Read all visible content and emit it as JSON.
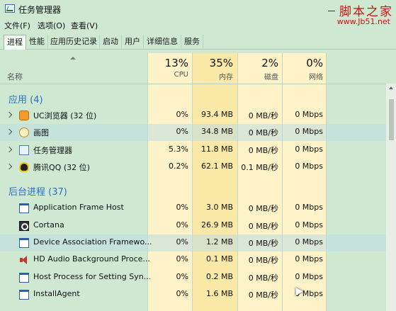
{
  "window": {
    "title": "任务管理器"
  },
  "watermark": {
    "text": "脚本之家",
    "url": "www.Jb51.net"
  },
  "menu": [
    "文件(F)",
    "选项(O)",
    "查看(V)"
  ],
  "tabs": [
    "进程",
    "性能",
    "应用历史记录",
    "启动",
    "用户",
    "详细信息",
    "服务"
  ],
  "active_tab": "进程",
  "header": {
    "name": "名称",
    "cpu_pct": "13%",
    "cpu": "CPU",
    "mem_pct": "35%",
    "mem": "内存",
    "disk_pct": "2%",
    "disk": "磁盘",
    "net_pct": "0%",
    "net": "网络"
  },
  "groups": {
    "apps": "应用 (4)",
    "background": "后台进程 (37)"
  },
  "apps": [
    {
      "name": "UC浏览器 (32 位)",
      "icon": "uc-browser-icon",
      "cpu": "0%",
      "mem": "93.4 MB",
      "disk": "0 MB/秒",
      "net": "0 Mbps"
    },
    {
      "name": "画图",
      "icon": "paint-icon",
      "cpu": "0%",
      "mem": "34.8 MB",
      "disk": "0 MB/秒",
      "net": "0 Mbps",
      "selected": true
    },
    {
      "name": "任务管理器",
      "icon": "task-manager-icon",
      "cpu": "5.3%",
      "mem": "11.8 MB",
      "disk": "0 MB/秒",
      "net": "0 Mbps"
    },
    {
      "name": "腾讯QQ (32 位)",
      "icon": "qq-icon",
      "cpu": "0.2%",
      "mem": "62.1 MB",
      "disk": "0.1 MB/秒",
      "net": "0 Mbps"
    }
  ],
  "background": [
    {
      "name": "Application Frame Host",
      "icon": "window-icon",
      "cpu": "0%",
      "mem": "3.0 MB",
      "disk": "0 MB/秒",
      "net": "0 Mbps"
    },
    {
      "name": "Cortana",
      "icon": "cortana-icon",
      "cpu": "0%",
      "mem": "26.9 MB",
      "disk": "0 MB/秒",
      "net": "0 Mbps"
    },
    {
      "name": "Device Association Framewo...",
      "icon": "window-icon",
      "cpu": "0%",
      "mem": "1.2 MB",
      "disk": "0 MB/秒",
      "net": "0 Mbps",
      "selected": true
    },
    {
      "name": "HD Audio Background Proce...",
      "icon": "speaker-icon",
      "cpu": "0%",
      "mem": "0.1 MB",
      "disk": "0 MB/秒",
      "net": "0 Mbps"
    },
    {
      "name": "Host Process for Setting Syn...",
      "icon": "window-icon",
      "cpu": "0%",
      "mem": "0.2 MB",
      "disk": "0 MB/秒",
      "net": "0 Mbps"
    },
    {
      "name": "InstallAgent",
      "icon": "window-icon",
      "cpu": "0%",
      "mem": "1.6 MB",
      "disk": "0 MB/秒",
      "net": "0 Mbps"
    }
  ],
  "colors": {
    "background": "#cfe8d2",
    "heat_light": "#fdf2c8",
    "heat_mid": "#fbe9a8",
    "group_title": "#2b6fc0"
  }
}
